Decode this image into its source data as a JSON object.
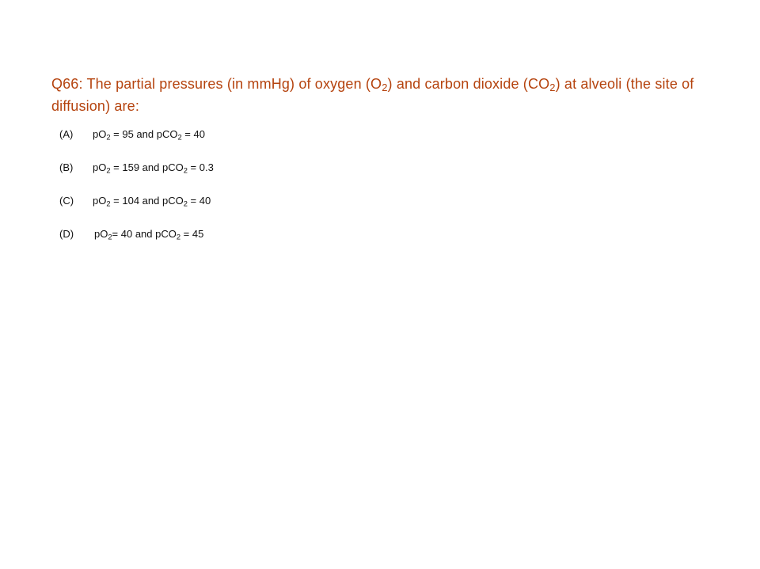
{
  "question": {
    "lead": "Q66: The partial pressures (in mmHg) of oxygen (O",
    "sub1": "2",
    "mid": ") and carbon dioxide (CO",
    "sub2": "2",
    "tail": ") at alveoli (the site of diffusion) are:"
  },
  "options": [
    {
      "letter": "(A)",
      "p1": "pO",
      "s1": "2",
      "p2": " = 95 and pCO",
      "s2": "2",
      "p3": " = 40"
    },
    {
      "letter": "(B)",
      "p1": "pO",
      "s1": "2",
      "p2": " = 159 and pCO",
      "s2": "2",
      "p3": " = 0.3"
    },
    {
      "letter": "(C)",
      "p1": "pO",
      "s1": "2",
      "p2": " = 104 and pCO",
      "s2": "2",
      "p3": " = 40"
    },
    {
      "letter": "(D)",
      "p1": "pO",
      "s1": "2",
      "p2": "= 40 and pCO",
      "s2": "2",
      "p3": " = 45"
    }
  ]
}
